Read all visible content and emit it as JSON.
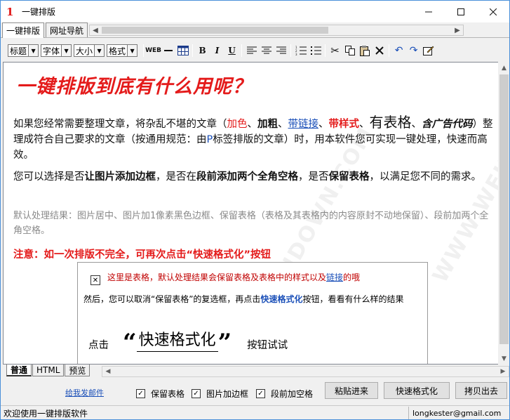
{
  "window": {
    "title": "一键排版",
    "logo": "1",
    "min_icon": "minimize-icon",
    "max_icon": "maximize-icon",
    "close_icon": "close-icon"
  },
  "tabs": [
    {
      "label": "一键排版"
    },
    {
      "label": "网址导航"
    }
  ],
  "toolbar": {
    "selects": [
      {
        "value": "标题"
      },
      {
        "value": "字体"
      },
      {
        "value": "大小"
      },
      {
        "value": "格式"
      }
    ],
    "bold": "B",
    "italic": "I",
    "underline": "U"
  },
  "editor": {
    "heading": "一键排版到底有什么用呢？",
    "p1": {
      "a": "如果您经常需要整理文章，将杂乱不堪的文章（",
      "color": "加色",
      "sep1": "、",
      "bold": "加粗",
      "sep2": "、",
      "link": "带链接",
      "sep3": "、",
      "style": "带样式",
      "sep4": "、",
      "table": "有表格",
      "sep5": "、",
      "code": "含广告代码",
      "b": "）整理成符合自己要求的文章（按通用规范：由",
      "p": "P",
      "c": "标签排版的文章）时，用本软件您可实现一键处理，快速而高效。"
    },
    "p2": {
      "a": "您可以选择是否",
      "b1": "让图片添加边框",
      "c": "，是否在",
      "b2": "段前添加两个全角空格",
      "d": "，是否",
      "b3": "保留表格",
      "e": "，以满足您不同的需求。"
    },
    "p3": "默认处理结果：图片居中、图片加1像素黑色边框、保留表格（表格及其表格内的内容原封不动地保留）、段前加两个全角空格。",
    "note": "注意：如一次排版不完全，可再次点击“快速格式化”按钮",
    "table_box": {
      "line1_a": "这里是表格，默认处理结果会保留表格及表格中的样式以及",
      "line1_link": "链接",
      "line1_b": "的哦",
      "line2_a": "然后，您可以取消“保留表格”的复选框，再点击",
      "line2_b": "快速格式化",
      "line2_c": "按钮，看看有什么样的结果",
      "click": "点击",
      "open_quote": "“",
      "ksf": "快速格式化",
      "close_quote": "”",
      "try": "按钮试试"
    },
    "watermark": "WWW.WEIDOWN.COM"
  },
  "bottom_tabs": [
    {
      "label": "普通"
    },
    {
      "label": "HTML"
    },
    {
      "label": "预览"
    }
  ],
  "bottom": {
    "mail_link": "给我发邮件",
    "checkboxes": [
      {
        "label": "保留表格",
        "checked": true
      },
      {
        "label": "图片加边框",
        "checked": true
      },
      {
        "label": "段前加空格",
        "checked": true
      }
    ],
    "buttons": [
      {
        "label": "粘贴进来"
      },
      {
        "label": "快速格式化"
      },
      {
        "label": "拷贝出去"
      }
    ]
  },
  "status": {
    "left": "欢迎使用一键排版软件",
    "right": "longkester@gmail.com"
  }
}
